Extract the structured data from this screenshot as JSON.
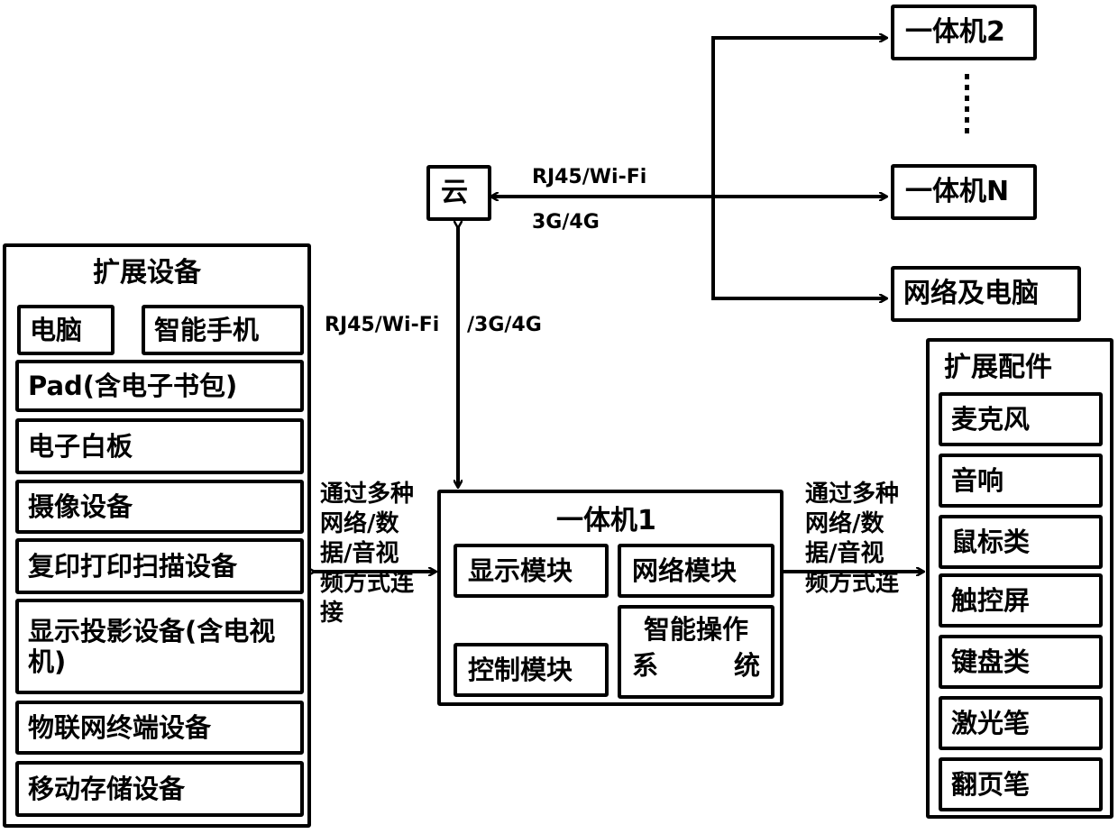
{
  "cloud": {
    "label": "云"
  },
  "top_links": {
    "label_upper": "RJ45/Wi-Fi",
    "label_lower": "3G/4G",
    "vertical_label_left": "RJ45/Wi-Fi",
    "vertical_label_right": "/3G/4G"
  },
  "remote_targets": [
    {
      "label": "一体机2"
    },
    {
      "label": "一体机N"
    },
    {
      "label": "网络及电脑"
    }
  ],
  "ellipsis": "……",
  "expansion_devices": {
    "title": "扩展设备",
    "row1": [
      "电脑",
      "智能手机"
    ],
    "items": [
      "Pad(含电子书包)",
      "电子白板",
      "摄像设备",
      "复印打印扫描设备",
      "显示投影设备(含电视机)",
      "物联网终端设备",
      "移动存储设备"
    ]
  },
  "main_unit": {
    "title": "一体机1",
    "modules": {
      "display": "显示模块",
      "network": "网络模块",
      "control": "控制模块",
      "os_line1": "智能操作",
      "os_line2_a": "系",
      "os_line2_b": "统"
    }
  },
  "connection_left": {
    "lines": [
      "通过多种",
      "网络/数",
      "据/音视",
      "频方式连",
      "接"
    ]
  },
  "connection_right": {
    "lines": [
      "通过多种",
      "网络/数",
      "据/音视",
      "频方式连"
    ]
  },
  "accessories": {
    "title": "扩展配件",
    "items": [
      "麦克风",
      "音响",
      "鼠标类",
      "触控屏",
      "键盘类",
      "激光笔",
      "翻页笔"
    ]
  }
}
